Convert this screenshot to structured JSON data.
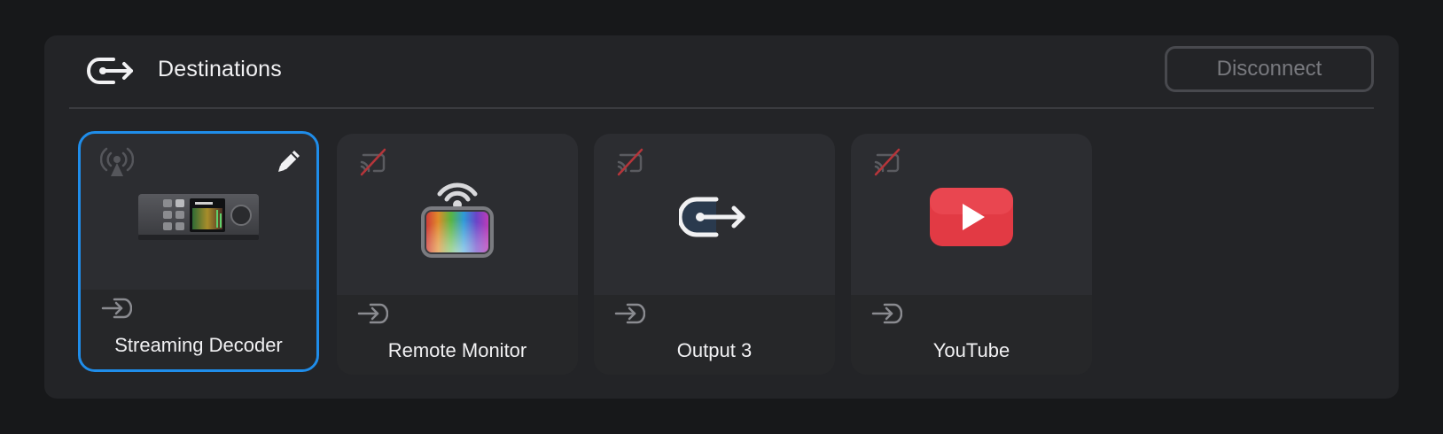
{
  "header": {
    "title": "Destinations",
    "icon": "output-icon",
    "disconnect_label": "Disconnect"
  },
  "colors": {
    "panel_bg": "#232427",
    "card_bg": "#2c2d31",
    "selected_border": "#1f8dea",
    "text": "#f1f1f3",
    "muted": "#78797e",
    "youtube_red": "#e23a44"
  },
  "destinations": [
    {
      "label": "Streaming Decoder",
      "status_icon": "broadcast-icon",
      "thumb_icon": "streaming-decoder-device-icon",
      "selected": true,
      "editable": true
    },
    {
      "label": "Remote Monitor",
      "status_icon": "cast-off-icon",
      "thumb_icon": "remote-monitor-app-icon",
      "selected": false,
      "editable": false
    },
    {
      "label": "Output 3",
      "status_icon": "cast-off-icon",
      "thumb_icon": "output-icon",
      "selected": false,
      "editable": false
    },
    {
      "label": "YouTube",
      "status_icon": "cast-off-icon",
      "thumb_icon": "youtube-icon",
      "selected": false,
      "editable": false
    }
  ]
}
